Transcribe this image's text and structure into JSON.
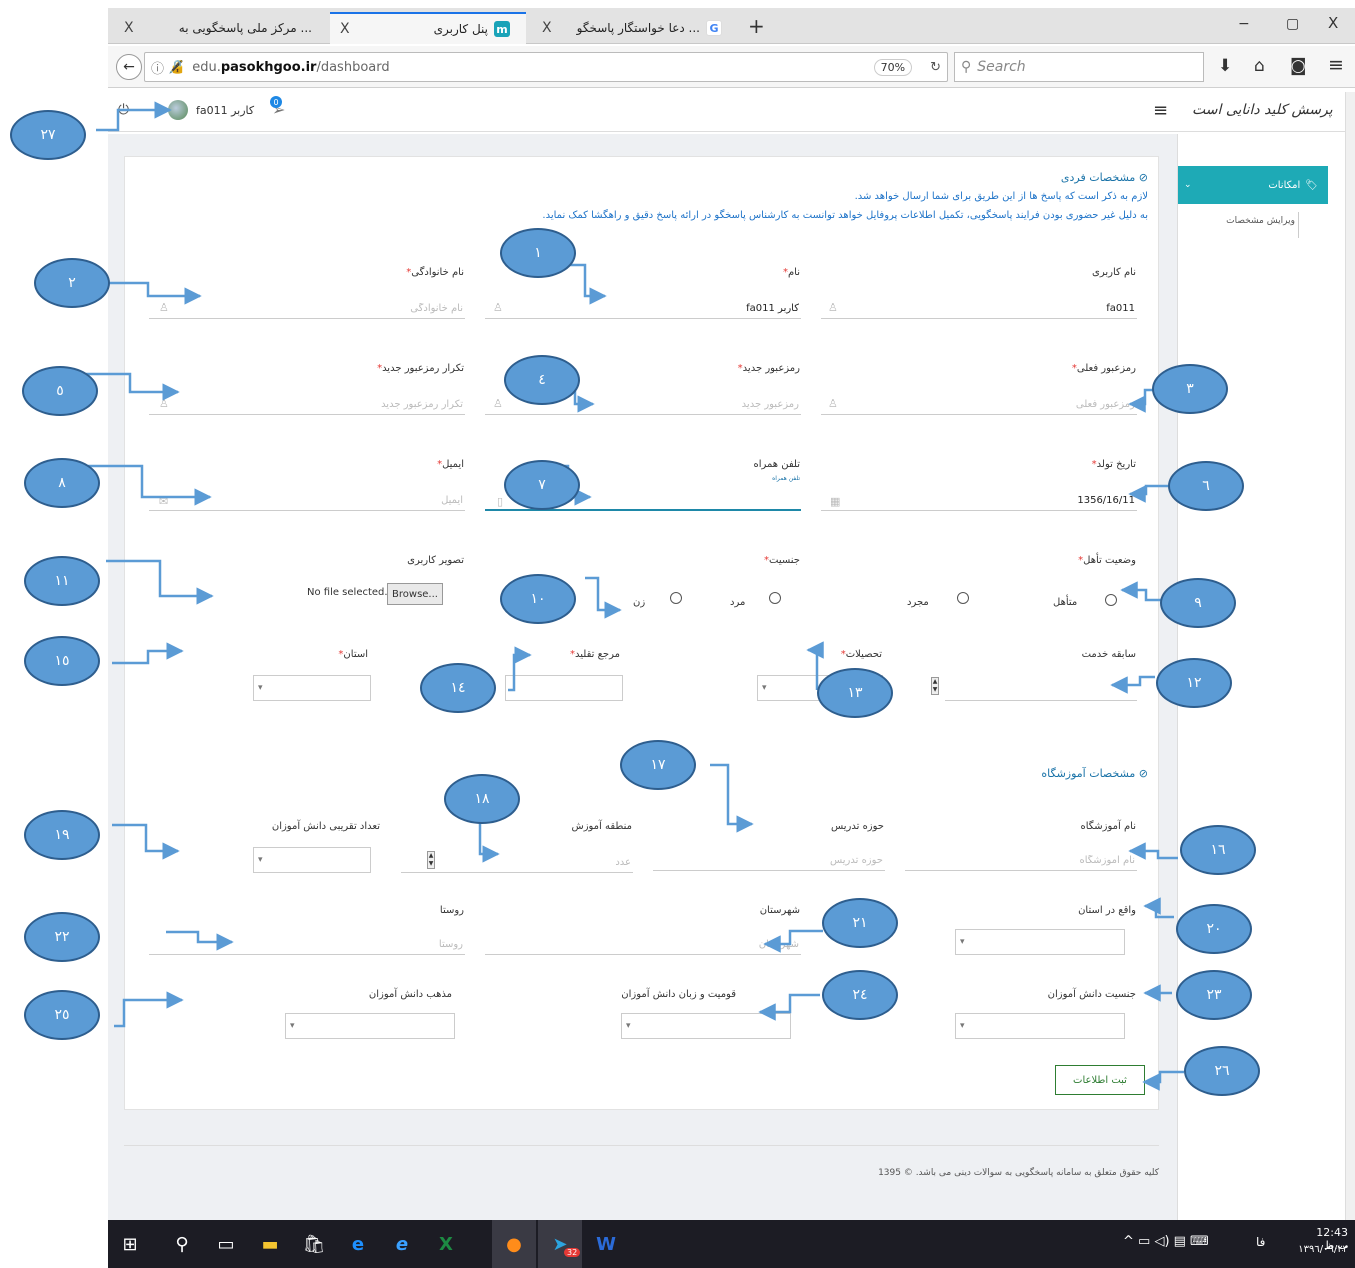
{
  "browser": {
    "tabs": [
      {
        "label": "... مرکز ملی پاسخگویی به",
        "icon": "site-icon"
      },
      {
        "label": "پنل کاربری",
        "icon": "m-logo-icon"
      },
      {
        "label": "... دعا خواستگار پاسخگو",
        "icon": "google-g-icon"
      }
    ],
    "new_tab": "+",
    "close": "X",
    "url_domain": "pasokhgoo.ir",
    "url_prefix": "edu.",
    "url_path": "/dashboard",
    "zoom": "70%",
    "search_placeholder": "Search",
    "window_controls": [
      "−",
      "▢",
      "X"
    ]
  },
  "header": {
    "logo_text": "پرسش کلید دانایی است",
    "user_label": "کاربر fa011",
    "notification_count": "0"
  },
  "sidebar": {
    "menu_title": "امکانات",
    "items": [
      {
        "label": "ویرایش مشخصات"
      }
    ]
  },
  "form": {
    "section1_title": "مشخصات فردی",
    "note1": "لازم به ذکر است که پاسخ ها از این طریق برای شما ارسال خواهد شد.",
    "note2": "به دلیل غیر حضوری بودن فرایند پاسخگویی، تکمیل اطلاعات پروفایل خواهد توانست به کارشناس پاسخگو در ارائه پاسخ دقیق و راهگشا کمک نماید.",
    "username": {
      "label": "نام کاربری",
      "value": "fa011"
    },
    "name": {
      "label": "نام",
      "value": "کاربر fa011"
    },
    "lastname": {
      "label": "نام خانوادگی",
      "placeholder": "نام خانوادگی"
    },
    "current_password": {
      "label": "رمزعبور فعلی",
      "placeholder": "رمزعبور فعلی"
    },
    "new_password": {
      "label": "رمزعبور جدید",
      "placeholder": "رمزعبور جدید"
    },
    "repeat_password": {
      "label": "تکرار رمزعبور جدید",
      "placeholder": "تکرار رمزعبور جدید"
    },
    "birthdate": {
      "label": "تاریخ تولد",
      "value": "1356/16/11"
    },
    "mobile": {
      "label": "تلفن همراه",
      "hint": "تلفن همراه"
    },
    "email": {
      "label": "ایمیل",
      "placeholder": "ایمیل"
    },
    "marital": {
      "label": "وضعیت تأهل",
      "options": [
        "متأهل",
        "مجرد"
      ]
    },
    "gender": {
      "label": "جنسیت",
      "options": [
        "مرد",
        "زن"
      ]
    },
    "photo": {
      "label": "تصویر کاربری",
      "button": "Browse...",
      "status": "No file selected."
    },
    "service_years": {
      "label": "سابقه خدمت"
    },
    "education": {
      "label": "تحصیلات"
    },
    "marja": {
      "label": "مرجع تقلید"
    },
    "province": {
      "label": "استان"
    },
    "section2_title": "مشخصات آموزشگاه",
    "school_name": {
      "label": "نام آموزشگاه",
      "placeholder": "نام آموزشگاه"
    },
    "teaching_field": {
      "label": "حوزه تدریس",
      "placeholder": "حوزه تدریس"
    },
    "edu_region": {
      "label": "منطقه آموزش",
      "placeholder": "عدد"
    },
    "student_count": {
      "label": "تعداد تقریبی دانش آموزان"
    },
    "school_province": {
      "label": "واقع در استان"
    },
    "city": {
      "label": "شهرستان",
      "placeholder": "شهرستان"
    },
    "village": {
      "label": "روستا",
      "placeholder": "روستا"
    },
    "student_gender": {
      "label": "جنسیت دانش آموزان"
    },
    "student_ethnicity": {
      "label": "قومیت و زبان دانش آموزان"
    },
    "student_religion": {
      "label": "مذهب دانش آموزان"
    },
    "submit": "ثبت اطلاعات",
    "footer": "کلیه حقوق متعلق به سامانه پاسخگویی به سوالات دینی می باشد. © 1395"
  },
  "annotations": [
    "۱",
    "۲",
    "۳",
    "٤",
    "٥",
    "٦",
    "۷",
    "۸",
    "۹",
    "۱۰",
    "۱۱",
    "۱۲",
    "۱۳",
    "۱٤",
    "۱٥",
    "۱٦",
    "۱۷",
    "۱۸",
    "۱۹",
    "۲۰",
    "۲۱",
    "۲۲",
    "۲۳",
    "۲٤",
    "۲٥",
    "۲٦",
    "۲۷"
  ],
  "taskbar": {
    "time": "12:43 ب.ظ",
    "date": "۱۳۹٦/۰۹/۲۳",
    "lang": "فا",
    "telegram_badge": "32"
  }
}
